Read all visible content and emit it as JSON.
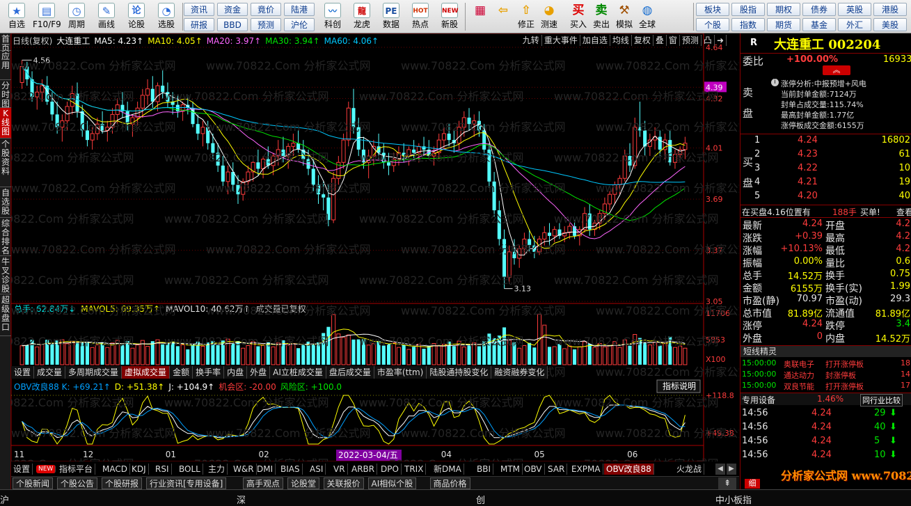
{
  "toolbar": {
    "buttons": [
      {
        "label": "自选",
        "icon": "star-icon",
        "color": "#2a6ad8"
      },
      {
        "label": "F10/F9",
        "icon": "monitor-icon",
        "color": "#2a6ad8"
      },
      {
        "label": "周期",
        "icon": "clock-icon",
        "color": "#2a6ad8"
      },
      {
        "label": "画线",
        "icon": "pencil-icon",
        "color": "#2a6ad8"
      },
      {
        "label": "论股",
        "icon": "lun-icon",
        "color": "#2a6ad8"
      },
      {
        "label": "选股",
        "icon": "gauge-icon",
        "color": "#2a6ad8"
      }
    ],
    "small_buttons": [
      [
        "资讯",
        "资金",
        "竟价",
        "陆港"
      ],
      [
        "研报",
        "BBD",
        "预测",
        "沪伦"
      ]
    ],
    "mid_buttons": [
      {
        "label": "科创",
        "icon": "chart-icon"
      },
      {
        "label": "龙虎",
        "icon": "dragon-icon"
      },
      {
        "label": "数据",
        "icon": "pe-icon"
      },
      {
        "label": "热点",
        "icon": "hot-icon"
      },
      {
        "label": "新股",
        "icon": "new-icon"
      }
    ],
    "right_buttons": [
      {
        "label": "",
        "icon": "grid-icon"
      },
      {
        "label": "",
        "icon": "back-arrow-icon"
      },
      {
        "label": "修正",
        "icon": "up-arrow-icon"
      },
      {
        "label": "测速",
        "icon": "speedometer-icon"
      },
      {
        "label": "买入",
        "icon": "buy-icon",
        "glyph": "买"
      },
      {
        "label": "卖出",
        "icon": "sell-icon",
        "glyph": "卖"
      },
      {
        "label": "模拟",
        "icon": "hammer-icon"
      },
      {
        "label": "全球",
        "icon": "globe-icon"
      }
    ],
    "far_small": [
      [
        "板块",
        "股指",
        "期权",
        "债券",
        "英股",
        "港股"
      ],
      [
        "个股",
        "指数",
        "期货",
        "基金",
        "外汇",
        "美股"
      ]
    ]
  },
  "leftnav": [
    "首页",
    "应用",
    "分时图",
    "K线图",
    "个股资料",
    "自选股",
    "综合排名",
    "牛叉诊股",
    "超级盘口"
  ],
  "chart": {
    "main_legend": [
      {
        "text": "日线(复权)",
        "color": "#c8c8c8"
      },
      {
        "text": "大连重工",
        "color": "#ffffff"
      },
      {
        "text": "MA5: 4.23↑",
        "color": "#ffffff"
      },
      {
        "text": "MA10: 4.05↑",
        "color": "#ffff00"
      },
      {
        "text": "MA20: 3.97↑",
        "color": "#ff66ff"
      },
      {
        "text": "MA30: 3.94↑",
        "color": "#00e600"
      },
      {
        "text": "MA60: 4.06↑",
        "color": "#00c8ff"
      }
    ],
    "tools": [
      "九转",
      "重大事件",
      "加自选",
      "均线",
      "复权",
      "叠",
      "窗",
      "预测",
      "凸"
    ],
    "price_labels": [
      "4.64",
      "4.39",
      "4.32",
      "4.01",
      "3.69",
      "3.37",
      "3.05"
    ],
    "high_label": "4.56",
    "low_label": "3.13",
    "vol_legend": [
      {
        "text": "总手: 62.84万↓",
        "color": "#00e0e0"
      },
      {
        "text": "MAVOL5: 69.35万↑",
        "color": "#ffff00"
      },
      {
        "text": "MAVOL10: 40.62万↑",
        "color": "#e6e6e6"
      },
      {
        "text": "成交量已复权",
        "color": "#c8c8c8"
      }
    ],
    "vol_labels": [
      "11706",
      "5853",
      "X100"
    ],
    "sub_tabs": [
      "设置",
      "成交量",
      "多周期成交量",
      "虚拟成交量",
      "金额",
      "换手率",
      "内盘",
      "外盘",
      "AI立桩成交量",
      "盘后成交量",
      "市盈率(ttm)",
      "陆股通持股变化",
      "融资融券变化"
    ],
    "sub_tab_active": "虚拟成交量",
    "ind_legend": [
      {
        "text": "OBV改良88 K: +69.21↑",
        "color": "#00a0ff"
      },
      {
        "text": "D: +51.38↑",
        "color": "#ffff00"
      },
      {
        "text": "J: +104.9↑",
        "color": "#ffffff"
      },
      {
        "text": "机会区: -20.00",
        "color": "#ff3c3c"
      },
      {
        "text": "风险区: +100.0",
        "color": "#00e600"
      }
    ],
    "ind_button": "指标说明",
    "ind_labels": [
      "+118.8",
      "+49.38"
    ],
    "months": [
      "11",
      "12",
      "01",
      "02",
      "03",
      "04",
      "05",
      "06"
    ],
    "date_marker": "2022-03-04/五",
    "candles": [
      [
        4.42,
        4.56,
        4.38,
        4.52
      ],
      [
        4.52,
        4.55,
        4.4,
        4.44
      ],
      [
        4.44,
        4.49,
        4.3,
        4.33
      ],
      [
        4.33,
        4.4,
        4.25,
        4.36
      ],
      [
        4.36,
        4.44,
        4.3,
        4.4
      ],
      [
        4.4,
        4.46,
        4.28,
        4.3
      ],
      [
        4.3,
        4.36,
        4.18,
        4.22
      ],
      [
        4.22,
        4.3,
        4.1,
        4.14
      ],
      [
        4.14,
        4.22,
        4.05,
        4.18
      ],
      [
        4.18,
        4.3,
        4.12,
        4.27
      ],
      [
        4.27,
        4.4,
        4.22,
        4.35
      ],
      [
        4.35,
        4.42,
        4.2,
        4.24
      ],
      [
        4.24,
        4.28,
        4.08,
        4.12
      ],
      [
        4.12,
        4.18,
        4.02,
        4.06
      ],
      [
        4.06,
        4.14,
        4.0,
        4.1
      ],
      [
        4.1,
        4.2,
        4.06,
        4.16
      ],
      [
        4.16,
        4.24,
        4.1,
        4.12
      ],
      [
        4.12,
        4.18,
        4.05,
        4.14
      ],
      [
        4.14,
        4.26,
        4.1,
        4.22
      ],
      [
        4.22,
        4.32,
        4.16,
        4.28
      ],
      [
        4.28,
        4.36,
        4.2,
        4.24
      ],
      [
        4.24,
        4.3,
        4.12,
        4.16
      ],
      [
        4.16,
        4.22,
        4.08,
        4.2
      ],
      [
        4.2,
        4.3,
        4.15,
        4.26
      ],
      [
        4.26,
        4.38,
        4.2,
        4.34
      ],
      [
        4.34,
        4.44,
        4.28,
        4.38
      ],
      [
        4.38,
        4.46,
        4.26,
        4.3
      ],
      [
        4.3,
        4.42,
        4.24,
        4.4
      ],
      [
        4.4,
        4.5,
        4.32,
        4.36
      ],
      [
        4.36,
        4.42,
        4.26,
        4.3
      ],
      [
        4.3,
        4.36,
        4.22,
        4.28
      ],
      [
        4.28,
        4.34,
        4.2,
        4.24
      ],
      [
        4.24,
        4.3,
        4.18,
        4.28
      ],
      [
        4.28,
        4.34,
        4.22,
        4.26
      ],
      [
        4.26,
        4.3,
        4.14,
        4.16
      ],
      [
        4.16,
        4.22,
        4.06,
        4.1
      ],
      [
        4.1,
        4.18,
        4.02,
        4.14
      ],
      [
        4.14,
        4.18,
        4.0,
        4.04
      ],
      [
        4.04,
        4.1,
        3.94,
        3.98
      ],
      [
        3.98,
        4.04,
        3.86,
        3.9
      ],
      [
        3.9,
        3.96,
        3.76,
        3.8
      ],
      [
        3.8,
        3.9,
        3.72,
        3.86
      ],
      [
        3.86,
        3.92,
        3.74,
        3.78
      ],
      [
        3.78,
        3.84,
        3.66,
        3.72
      ],
      [
        3.72,
        3.82,
        3.68,
        3.8
      ],
      [
        3.8,
        3.9,
        3.76,
        3.86
      ],
      [
        3.86,
        3.96,
        3.8,
        3.92
      ],
      [
        3.92,
        4.0,
        3.84,
        3.88
      ],
      [
        3.88,
        3.96,
        3.82,
        3.94
      ],
      [
        3.94,
        4.02,
        3.88,
        3.9
      ],
      [
        3.9,
        3.98,
        3.84,
        3.96
      ],
      [
        3.96,
        4.06,
        3.9,
        4.0
      ],
      [
        4.0,
        4.08,
        3.92,
        3.96
      ],
      [
        3.96,
        4.04,
        3.88,
        4.02
      ],
      [
        4.02,
        4.1,
        3.96,
        4.04
      ],
      [
        4.04,
        4.12,
        3.98,
        4.0
      ],
      [
        4.0,
        4.06,
        3.9,
        3.94
      ],
      [
        3.94,
        4.0,
        3.84,
        3.88
      ],
      [
        3.88,
        3.94,
        3.74,
        3.78
      ],
      [
        3.78,
        3.84,
        3.66,
        3.72
      ],
      [
        3.72,
        3.8,
        3.62,
        3.7
      ],
      [
        3.7,
        3.78,
        3.52,
        3.56
      ],
      [
        3.56,
        3.86,
        3.54,
        3.82
      ],
      [
        3.82,
        3.96,
        3.78,
        3.92
      ],
      [
        3.92,
        4.1,
        3.88,
        4.06
      ],
      [
        4.06,
        4.3,
        4.02,
        4.26
      ],
      [
        4.26,
        4.38,
        4.1,
        4.14
      ],
      [
        4.14,
        4.2,
        3.96,
        4.0
      ],
      [
        4.0,
        4.08,
        3.88,
        3.92
      ],
      [
        3.92,
        4.0,
        3.82,
        3.96
      ],
      [
        3.96,
        4.06,
        3.9,
        4.02
      ],
      [
        4.02,
        4.1,
        3.94,
        3.98
      ],
      [
        3.98,
        4.04,
        3.88,
        3.92
      ],
      [
        3.92,
        3.98,
        3.84,
        3.9
      ],
      [
        3.9,
        3.98,
        3.86,
        3.94
      ],
      [
        3.94,
        4.02,
        3.9,
        3.98
      ],
      [
        3.98,
        4.04,
        3.92,
        3.96
      ],
      [
        3.96,
        4.02,
        3.9,
        4.0
      ],
      [
        4.0,
        4.06,
        3.94,
        3.98
      ],
      [
        3.98,
        4.04,
        3.92,
        4.02
      ],
      [
        4.02,
        4.08,
        3.96,
        4.0
      ],
      [
        4.0,
        4.06,
        3.94,
        3.96
      ],
      [
        3.96,
        4.02,
        3.9,
        3.98
      ],
      [
        3.98,
        4.1,
        3.94,
        4.06
      ],
      [
        4.06,
        4.14,
        4.0,
        4.1
      ],
      [
        4.1,
        4.16,
        4.02,
        4.06
      ],
      [
        4.06,
        4.12,
        3.98,
        4.04
      ],
      [
        4.04,
        4.18,
        4.0,
        4.14
      ],
      [
        4.14,
        4.24,
        4.08,
        4.2
      ],
      [
        4.2,
        4.26,
        4.12,
        4.16
      ],
      [
        4.16,
        4.22,
        4.08,
        4.18
      ],
      [
        4.18,
        4.24,
        4.08,
        4.12
      ],
      [
        4.12,
        4.16,
        3.96,
        4.0
      ],
      [
        4.0,
        4.04,
        3.76,
        3.8
      ],
      [
        3.8,
        3.86,
        3.58,
        3.62
      ],
      [
        3.62,
        3.68,
        3.4,
        3.44
      ],
      [
        3.44,
        3.5,
        3.13,
        3.2
      ],
      [
        3.2,
        3.4,
        3.16,
        3.36
      ],
      [
        3.36,
        3.44,
        3.28,
        3.32
      ],
      [
        3.32,
        3.4,
        3.26,
        3.38
      ],
      [
        3.38,
        3.48,
        3.34,
        3.44
      ],
      [
        3.44,
        3.5,
        3.36,
        3.4
      ],
      [
        3.4,
        3.46,
        3.32,
        3.36
      ],
      [
        3.36,
        3.46,
        3.34,
        3.44
      ],
      [
        3.44,
        3.52,
        3.4,
        3.48
      ],
      [
        3.48,
        3.54,
        3.4,
        3.46
      ],
      [
        3.46,
        3.52,
        3.42,
        3.5
      ],
      [
        3.5,
        3.54,
        3.44,
        3.46
      ],
      [
        3.46,
        3.52,
        3.42,
        3.48
      ],
      [
        3.48,
        3.54,
        3.44,
        3.52
      ],
      [
        3.52,
        3.56,
        3.44,
        3.46
      ],
      [
        3.46,
        3.52,
        3.4,
        3.5
      ],
      [
        3.5,
        3.64,
        3.48,
        3.6
      ],
      [
        3.6,
        3.66,
        3.46,
        3.5
      ],
      [
        3.5,
        3.56,
        3.46,
        3.54
      ],
      [
        3.54,
        3.62,
        3.5,
        3.6
      ],
      [
        3.6,
        3.7,
        3.56,
        3.66
      ],
      [
        3.66,
        3.74,
        3.62,
        3.72
      ],
      [
        3.72,
        3.8,
        3.66,
        3.78
      ],
      [
        3.78,
        3.84,
        3.72,
        3.82
      ],
      [
        3.82,
        4.0,
        3.8,
        3.96
      ],
      [
        3.96,
        4.04,
        3.86,
        3.9
      ],
      [
        3.9,
        4.2,
        3.88,
        4.14
      ],
      [
        4.14,
        4.3,
        4.08,
        4.12
      ],
      [
        4.12,
        4.18,
        3.96,
        4.02
      ],
      [
        4.02,
        4.1,
        3.96,
        4.06
      ],
      [
        4.06,
        4.14,
        4.0,
        4.08
      ],
      [
        4.08,
        4.12,
        3.96,
        4.0
      ],
      [
        4.0,
        4.1,
        3.94,
        4.06
      ],
      [
        4.06,
        4.12,
        3.9,
        3.92
      ],
      [
        3.92,
        4.0,
        3.88,
        3.97
      ],
      [
        3.97,
        4.02,
        3.92,
        4.0
      ],
      [
        4.0,
        4.08,
        3.94,
        4.04
      ]
    ]
  },
  "right": {
    "code": "R",
    "name": "大连重工 002204",
    "weibi_label": "委比",
    "weibi_value": "+100.00%",
    "weibi_extra": "16933",
    "sell_label": "卖盘",
    "buy_label": "买盘",
    "zt_lines": [
      "涨停分析:中报预增+风电",
      "当前封单金额:7124万",
      "封单占成交量:115.74%",
      "最高封单金额:1.77亿",
      "涨停板成交金额:6155万"
    ],
    "bids": [
      [
        "1",
        "4.24",
        "16802"
      ],
      [
        "2",
        "4.23",
        "61"
      ],
      [
        "3",
        "4.22",
        "10"
      ],
      [
        "4",
        "4.21",
        "19"
      ],
      [
        "5",
        "4.20",
        "40"
      ]
    ],
    "position_text": "在买盘4.16位置有",
    "position_vol": "188手",
    "position_action": "买单!",
    "position_link": "查看详",
    "quotes": [
      [
        "最新",
        "4.24",
        "red",
        "开盘",
        "4.2",
        "red"
      ],
      [
        "涨跌",
        "+0.39",
        "red",
        "最高",
        "4.2",
        "red"
      ],
      [
        "涨幅",
        "+10.13%",
        "red",
        "最低",
        "4.2",
        "red"
      ],
      [
        "振幅",
        "0.00%",
        "yellow",
        "量比",
        "0.6",
        "yellow"
      ],
      [
        "总手",
        "14.52万",
        "yellow",
        "换手",
        "0.75",
        "yellow"
      ],
      [
        "金额",
        "6155万",
        "yellow",
        "换手(实)",
        "1.99",
        "yellow"
      ],
      [
        "市盈(静)",
        "70.97",
        "white",
        "市盈(动)",
        "29.3",
        "white"
      ],
      [
        "总市值",
        "81.89亿",
        "yellow",
        "流通值",
        "81.89亿",
        "yellow"
      ],
      [
        "涨停",
        "4.24",
        "red",
        "跌停",
        "3.4",
        "green"
      ],
      [
        "外盘",
        "0",
        "red",
        "内盘",
        "14.52万",
        "yellow"
      ]
    ],
    "short_title": "短线精灵",
    "short_rows": [
      [
        "15:00:00",
        "奥联电子",
        "打开涨停板",
        "18"
      ],
      [
        "15:00:00",
        "通达动力",
        "封涨停板",
        "14"
      ],
      [
        "15:00:00",
        "双良节能",
        "打开涨停板",
        "17"
      ]
    ],
    "industry_label": "专用设备",
    "industry_pct": "1.46%",
    "industry_btn": "同行业比较",
    "ticks": [
      [
        "14:56",
        "4.24",
        "29"
      ],
      [
        "14:56",
        "4.24",
        "40"
      ],
      [
        "14:56",
        "4.24",
        "5"
      ],
      [
        "14:56",
        "4.24",
        "10"
      ]
    ],
    "detail_tab": "细"
  },
  "bottom_tabs": [
    "设置",
    "NEW",
    "指标平台",
    "MACD",
    "KDJ",
    "RSI",
    "BOLL",
    "主力",
    "W&R",
    "DMI",
    "BIAS",
    "ASI",
    "VR",
    "ARBR",
    "DPO",
    "TRIX",
    "新DMA",
    "BBI",
    "MTM",
    "OBV",
    "SAR",
    "EXPMA",
    "OBV改良88",
    "火龙战"
  ],
  "bottom_tab_active": "OBV改良88",
  "news": [
    "个股新闻",
    "个股公告",
    "个股研报",
    "行业资讯[专用设备]",
    "高手观点",
    "论股堂",
    "关联报价",
    "AI相似个股",
    "商品价格"
  ],
  "status": [
    "沪",
    "深",
    "创",
    "中小板指"
  ],
  "watermark": "分析家公式网 www.70822.com",
  "watermark_bg": "www.70822.Com 分析家公式网"
}
